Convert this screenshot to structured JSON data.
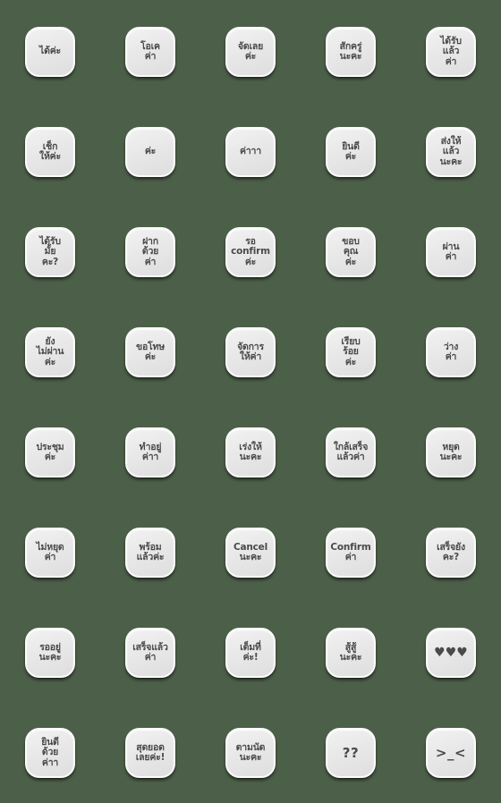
{
  "page": {
    "background_color": "#4c6049",
    "sticker_color": "#e9e9e9",
    "text_color": "#4a4a4a",
    "columns": 5,
    "rows": 8,
    "total_stickers": 40
  },
  "stickers": [
    {
      "id": 1,
      "text": "ได้ค่ะ",
      "style": "thai"
    },
    {
      "id": 2,
      "text": "โอเค\nค่า",
      "style": "thai"
    },
    {
      "id": 3,
      "text": "จัดเลย\nค่ะ",
      "style": "thai"
    },
    {
      "id": 4,
      "text": "สักครู่\nนะคะ",
      "style": "thai"
    },
    {
      "id": 5,
      "text": "ได้รับ\nแล้ว\nค่า",
      "style": "thai"
    },
    {
      "id": 6,
      "text": "เช็ก\nให้ค่ะ",
      "style": "thai"
    },
    {
      "id": 7,
      "text": "ค่ะ",
      "style": "thai"
    },
    {
      "id": 8,
      "text": "ค่าาา",
      "style": "thai"
    },
    {
      "id": 9,
      "text": "ยินดี\nค่ะ",
      "style": "thai"
    },
    {
      "id": 10,
      "text": "ส่งให้\nแล้ว\nนะคะ",
      "style": "thai"
    },
    {
      "id": 11,
      "text": "ได้รับ\nมั้ย\nคะ?",
      "style": "thai"
    },
    {
      "id": 12,
      "text": "ฝาก\nด้วย\nค่า",
      "style": "thai"
    },
    {
      "id": 13,
      "text": "รอ\nconfirm\nค่ะ",
      "style": "thai"
    },
    {
      "id": 14,
      "text": "ขอบ\nคุณ\nค่ะ",
      "style": "thai"
    },
    {
      "id": 15,
      "text": "ผ่าน\nค่า",
      "style": "thai"
    },
    {
      "id": 16,
      "text": "ยัง\nไม่ผ่าน\nค่ะ",
      "style": "thai"
    },
    {
      "id": 17,
      "text": "ขอโทษ\nค่ะ",
      "style": "thai"
    },
    {
      "id": 18,
      "text": "จัดการ\nให้ค่า",
      "style": "thai"
    },
    {
      "id": 19,
      "text": "เรียบ\nร้อย\nค่ะ",
      "style": "thai"
    },
    {
      "id": 20,
      "text": "ว่าง\nค่า",
      "style": "thai"
    },
    {
      "id": 21,
      "text": "ประชุม\nค่ะ",
      "style": "thai"
    },
    {
      "id": 22,
      "text": "ทำอยู่\nค่าา",
      "style": "thai"
    },
    {
      "id": 23,
      "text": "เร่งให้\nนะคะ",
      "style": "thai"
    },
    {
      "id": 24,
      "text": "ใกล้เสร็จ\nแล้วค่า",
      "style": "thai"
    },
    {
      "id": 25,
      "text": "หยุด\nนะคะ",
      "style": "thai"
    },
    {
      "id": 26,
      "text": "ไม่หยุด\nค่า",
      "style": "thai"
    },
    {
      "id": 27,
      "text": "พร้อม\nแล้วค่ะ",
      "style": "thai"
    },
    {
      "id": 28,
      "text": "Cancel\nนะคะ",
      "style": "thai"
    },
    {
      "id": 29,
      "text": "Confirm\nค่า",
      "style": "thai"
    },
    {
      "id": 30,
      "text": "เสร็จยัง\nคะ?",
      "style": "thai"
    },
    {
      "id": 31,
      "text": "รออยู่\nนะคะ",
      "style": "thai"
    },
    {
      "id": 32,
      "text": "เสร็จแล้ว\nค่า",
      "style": "thai"
    },
    {
      "id": 33,
      "text": "เต็มที่\nค่ะ!",
      "style": "thai"
    },
    {
      "id": 34,
      "text": "สู้สู้\nนะคะ",
      "style": "thai"
    },
    {
      "id": 35,
      "text": "♥♥♥",
      "style": "hearts"
    },
    {
      "id": 36,
      "text": "ยินดี\nด้วย\nค่าา",
      "style": "thai"
    },
    {
      "id": 37,
      "text": "สุดยอด\nเลยค่ะ!",
      "style": "thai"
    },
    {
      "id": 38,
      "text": "ตามนัด\nนะคะ",
      "style": "thai"
    },
    {
      "id": 39,
      "text": "??",
      "style": "symbol"
    },
    {
      "id": 40,
      "text": ">_<",
      "style": "symbol"
    }
  ]
}
